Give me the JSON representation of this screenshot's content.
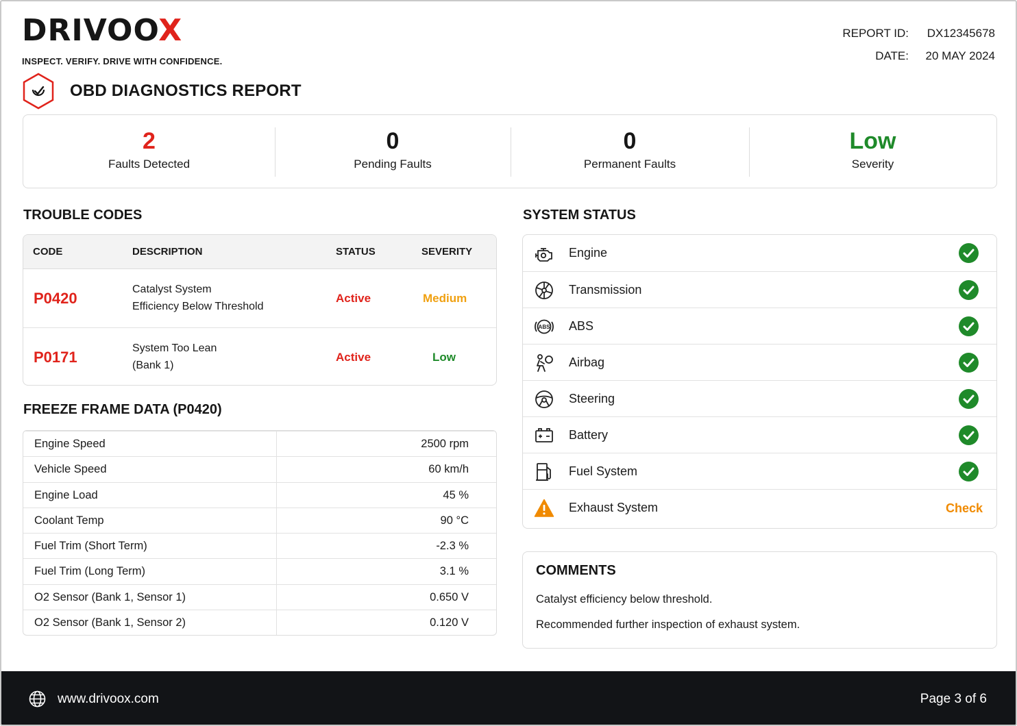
{
  "brand": {
    "logo_main": "DRIVOO",
    "logo_accent": "X",
    "tagline": "INSPECT. VERIFY. DRIVE WITH CONFIDENCE."
  },
  "meta": {
    "report_id_label": "REPORT ID:",
    "report_id": "DX12345678",
    "date_label": "DATE:",
    "date": "20 MAY 2024"
  },
  "report_title": "OBD DIAGNOSTICS REPORT",
  "summary": [
    {
      "value": "2",
      "label": "Faults Detected",
      "color": "#e0231b"
    },
    {
      "value": "0",
      "label": "Pending Faults",
      "color": "#161616"
    },
    {
      "value": "0",
      "label": "Permanent Faults",
      "color": "#161616"
    },
    {
      "value": "Low",
      "label": "Severity",
      "color": "#1f8a2a"
    }
  ],
  "trouble_codes": {
    "title": "TROUBLE CODES",
    "headers": {
      "code": "CODE",
      "description": "DESCRIPTION",
      "status": "STATUS",
      "severity": "SEVERITY"
    },
    "rows": [
      {
        "code": "P0420",
        "desc_line1": "Catalyst System",
        "desc_line2": "Efficiency Below Threshold",
        "status": "Active",
        "severity": "Medium",
        "severity_color": "#f0a010"
      },
      {
        "code": "P0171",
        "desc_line1": "System Too Lean",
        "desc_line2": "(Bank 1)",
        "status": "Active",
        "severity": "Low",
        "severity_color": "#1f8a2a"
      }
    ]
  },
  "freeze_frame": {
    "title": "FREEZE FRAME DATA (P0420)",
    "rows": [
      {
        "label": "Engine Speed",
        "value": "2500 rpm"
      },
      {
        "label": "Vehicle Speed",
        "value": "60 km/h"
      },
      {
        "label": "Engine Load",
        "value": "45 %"
      },
      {
        "label": "Coolant Temp",
        "value": "90 °C"
      },
      {
        "label": "Fuel Trim (Short Term)",
        "value": "-2.3 %"
      },
      {
        "label": "Fuel Trim (Long Term)",
        "value": "3.1 %"
      },
      {
        "label": "O2 Sensor (Bank 1, Sensor 1)",
        "value": "0.650 V"
      },
      {
        "label": "O2 Sensor (Bank 1, Sensor 2)",
        "value": "0.120 V"
      }
    ]
  },
  "system_status": {
    "title": "SYSTEM STATUS",
    "items": [
      {
        "name": "Engine",
        "icon": "engine-icon",
        "ok": true
      },
      {
        "name": "Transmission",
        "icon": "transmission-icon",
        "ok": true
      },
      {
        "name": "ABS",
        "icon": "abs-icon",
        "ok": true
      },
      {
        "name": "Airbag",
        "icon": "airbag-icon",
        "ok": true
      },
      {
        "name": "Steering",
        "icon": "steering-wheel-icon",
        "ok": true
      },
      {
        "name": "Battery",
        "icon": "battery-icon",
        "ok": true
      },
      {
        "name": "Fuel System",
        "icon": "fuel-pump-icon",
        "ok": true
      },
      {
        "name": "Exhaust System",
        "icon": "warning-icon",
        "ok": false,
        "status_text": "Check"
      }
    ]
  },
  "comments": {
    "title": "COMMENTS",
    "line1": "Catalyst efficiency below threshold.",
    "line2": "Recommended further inspection of exhaust system."
  },
  "footer": {
    "url": "www.drivoox.com",
    "page": "Page 3 of 6"
  }
}
